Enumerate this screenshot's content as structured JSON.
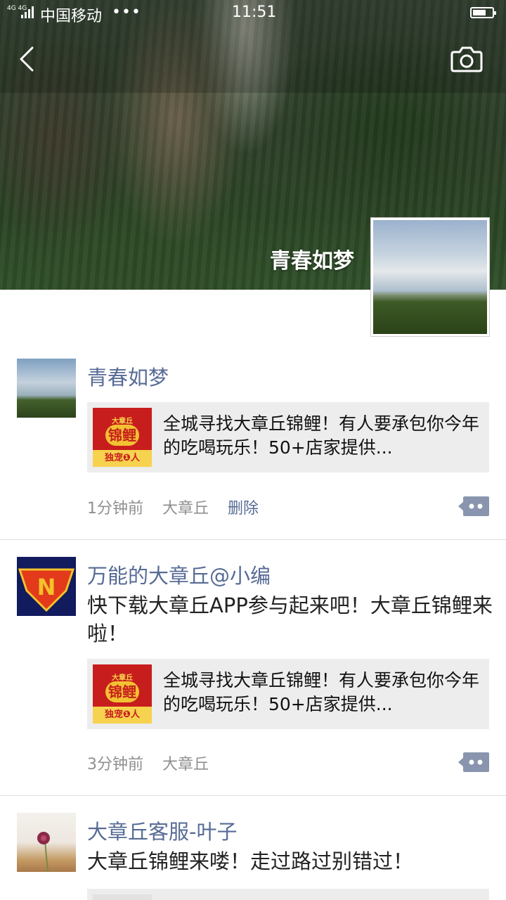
{
  "status_bar": {
    "signal_text": "4G 4G",
    "carrier": "中国移动",
    "dots": "•••",
    "time": "11:51"
  },
  "header": {
    "back_icon": "chevron-left-icon",
    "camera_icon": "camera-icon"
  },
  "profile": {
    "name": "青春如梦"
  },
  "posts": [
    {
      "author": "青春如梦",
      "text": "",
      "link_card": {
        "thumb_top": "大章丘",
        "thumb_main": "锦鲤",
        "thumb_bottom": "独宠❶人",
        "title": "全城寻找大章丘锦鲤！有人要承包你今年的吃喝玩乐！50+店家提供..."
      },
      "time": "1分钟前",
      "location": "大章丘",
      "delete_label": "删除"
    },
    {
      "author": "万能的大章丘@小编",
      "text": "快下载大章丘APP参与起来吧！大章丘锦鲤来啦！",
      "link_card": {
        "thumb_top": "大章丘",
        "thumb_main": "锦鲤",
        "thumb_bottom": "独宠❶人",
        "title": "全城寻找大章丘锦鲤！有人要承包你今年的吃喝玩乐！50+店家提供..."
      },
      "time": "3分钟前",
      "location": "大章丘"
    },
    {
      "author": "大章丘客服-叶子",
      "text": "大章丘锦鲤来喽！走过路过别错过！"
    }
  ],
  "colors": {
    "link": "#576b95",
    "meta": "#8f8f8f",
    "card_bg": "#ededed"
  }
}
